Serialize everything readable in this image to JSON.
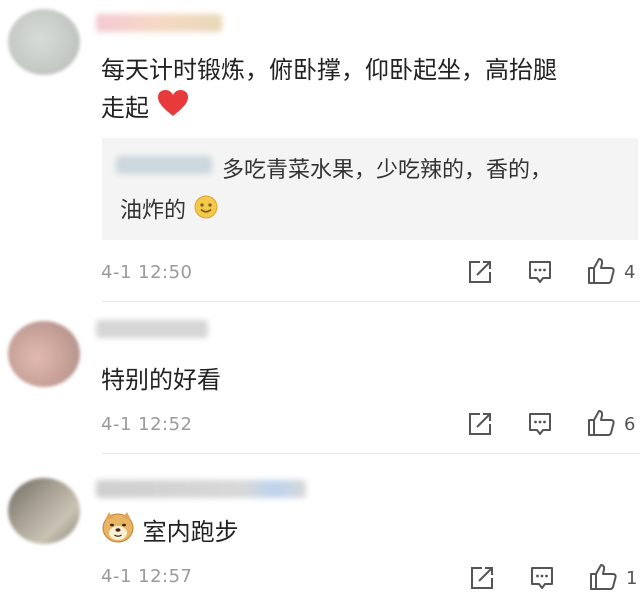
{
  "comments": [
    {
      "text_line1": "每天计时锻炼，俯卧撑，仰卧起坐，高抬腿",
      "text_line2": "走起",
      "reply": {
        "line1": "多吃青菜水果，少吃辣的，香的，",
        "line2": "油炸的"
      },
      "time": "4-1 12:50",
      "likes": "4"
    },
    {
      "text_line1": "特别的好看",
      "time": "4-1 12:52",
      "likes": "6"
    },
    {
      "text_line1": "室内跑步",
      "time": "4-1 12:57",
      "likes": "1"
    }
  ],
  "colors": {
    "heart": "#e83a3a",
    "text": "#222222",
    "meta": "#9a9a9a",
    "quote_bg": "#f4f4f4"
  },
  "icons": [
    "heart-icon",
    "smiley-icon",
    "doge-emoji-icon",
    "share-icon",
    "comment-icon",
    "like-icon"
  ]
}
